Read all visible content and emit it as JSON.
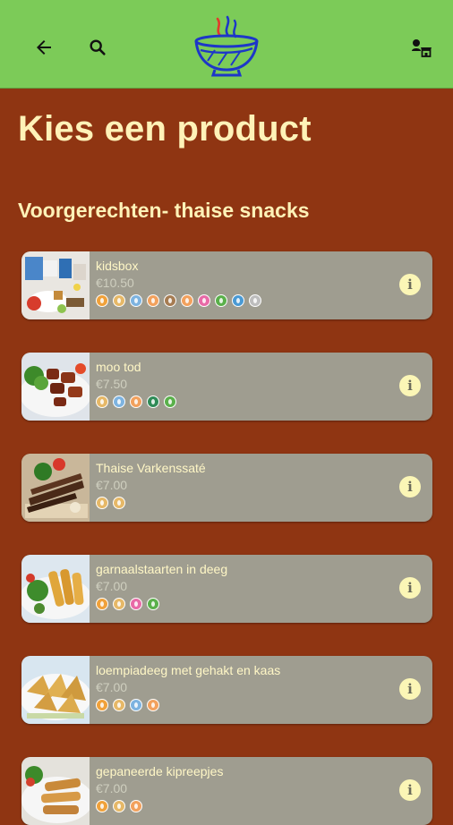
{
  "header": {
    "back_icon": "arrow-left-icon",
    "search_icon": "search-icon",
    "logo_icon": "steaming-bowl-logo",
    "right_icon": "user-store-icon",
    "colors": {
      "bar": "#7ccb58",
      "logo": "#1d37c8",
      "steam_red": "#e23b2b"
    }
  },
  "page": {
    "title": "Kies een product",
    "category": "Voorgerechten- thaise snacks"
  },
  "products": [
    {
      "name": "kidsbox",
      "price": "€10.50",
      "allergens": [
        "#f0a13a",
        "#e6b867",
        "#7db3e0",
        "#f2a15d",
        "#a67c52",
        "#f2a15d",
        "#e86aa7",
        "#5ab04b",
        "#4a9ad4",
        "#bdbdbd"
      ]
    },
    {
      "name": "moo tod",
      "price": "€7.50",
      "allergens": [
        "#e6b867",
        "#7db3e0",
        "#f2a15d",
        "#2f8b57",
        "#5ab04b"
      ]
    },
    {
      "name": "Thaise Varkenssaté",
      "price": "€7.00",
      "allergens": [
        "#e6b867",
        "#e6b867"
      ]
    },
    {
      "name": "garnaalstaarten in deeg",
      "price": "€7.00",
      "allergens": [
        "#f0a13a",
        "#e6b867",
        "#e86aa7",
        "#5ab04b"
      ]
    },
    {
      "name": "loempiadeeg met gehakt en kaas",
      "price": "€7.00",
      "allergens": [
        "#f0a13a",
        "#e6b867",
        "#7db3e0",
        "#f2a15d"
      ]
    },
    {
      "name": "gepaneerde kipreepjes",
      "price": "€7.00",
      "allergens": [
        "#f0a13a",
        "#e6b867",
        "#f2a15d"
      ]
    }
  ]
}
